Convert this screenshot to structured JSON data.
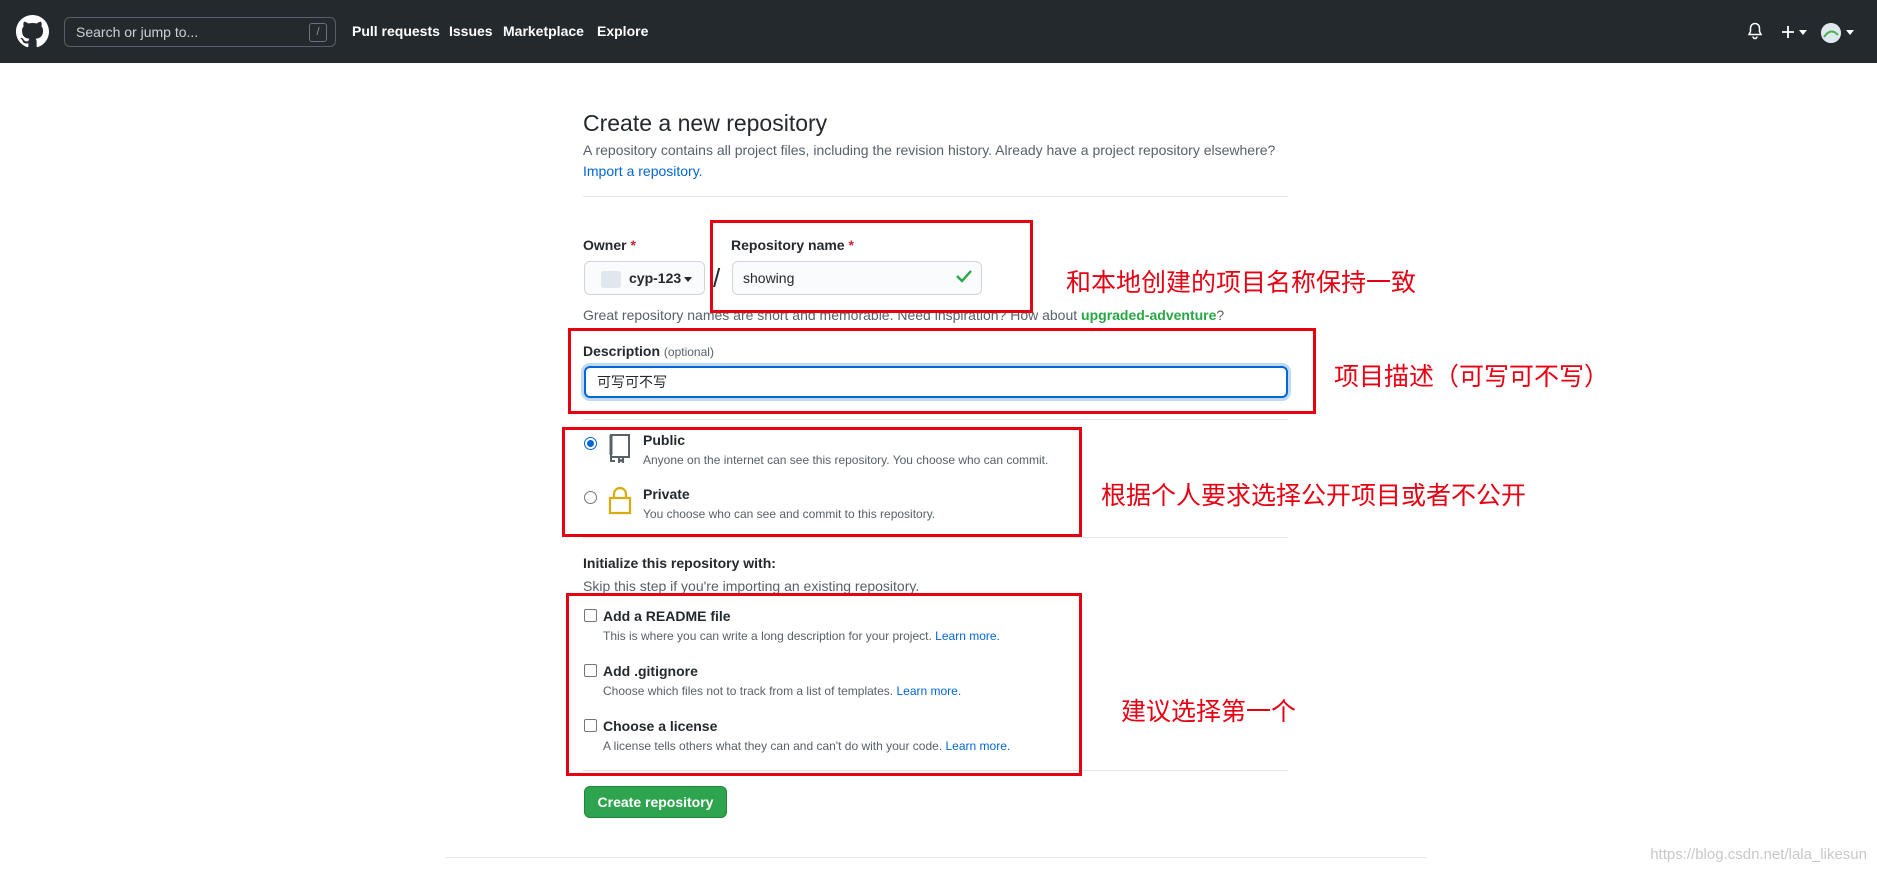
{
  "header": {
    "search_placeholder": "Search or jump to...",
    "search_shortcut": "/",
    "nav": [
      "Pull requests",
      "Issues",
      "Marketplace",
      "Explore"
    ],
    "icons": [
      "github-logo-icon",
      "bell-icon",
      "plus-icon",
      "avatar"
    ]
  },
  "page": {
    "title": "Create a new repository",
    "subtitle": "A repository contains all project files, including the revision history. Already have a project repository elsewhere?",
    "import_link": "Import a repository.",
    "owner_label": "Owner",
    "owner_value": "cyp-123",
    "repo_label": "Repository name",
    "required_mark": "*",
    "separator": "/",
    "repo_value": "showing",
    "hint_text": "Great repository names are short and memorable. Need inspiration? How about ",
    "hint_suggestion": "upgraded-adventure",
    "hint_end": "?",
    "desc_label": "Description",
    "desc_optional": "(optional)",
    "desc_value": "可写可不写",
    "visibility": [
      {
        "title": "Public",
        "desc": "Anyone on the internet can see this repository. You choose who can commit.",
        "selected": true
      },
      {
        "title": "Private",
        "desc": "You choose who can see and commit to this repository.",
        "selected": false
      }
    ],
    "init_title": "Initialize this repository with:",
    "init_sub": "Skip this step if you're importing an existing repository.",
    "init_options": [
      {
        "title": "Add a README file",
        "desc": "This is where you can write a long description for your project.",
        "link": "Learn more.",
        "checked": false
      },
      {
        "title": "Add .gitignore",
        "desc": "Choose which files not to track from a list of templates.",
        "link": "Learn more.",
        "checked": false
      },
      {
        "title": "Choose a license",
        "desc": "A license tells others what they can and can't do with your code.",
        "link": "Learn more.",
        "checked": false
      }
    ],
    "create_button": "Create repository"
  },
  "annotations": {
    "repo_name_note": "和本地创建的项目名称保持一致",
    "desc_note": "项目描述（可写可不写）",
    "visibility_note": "根据个人要求选择公开项目或者不公开",
    "init_note": "建议选择第一个",
    "color": "#e60012"
  },
  "watermark": "https://blog.csdn.net/lala_likesun"
}
